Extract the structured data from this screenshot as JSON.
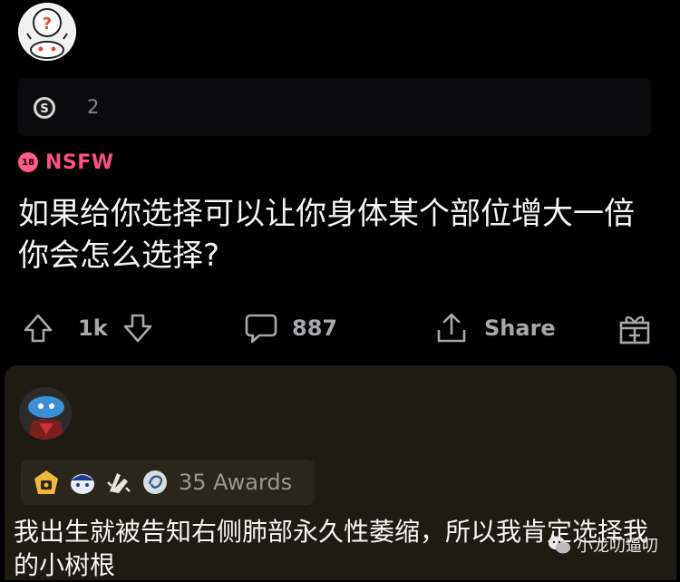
{
  "post": {
    "award_count": "2",
    "nsfw_badge": "18",
    "nsfw_label": "NSFW",
    "title": "如果给你选择可以让你身体某个部位增大一倍你会怎么选择?",
    "upvotes": "1k",
    "comments": "887",
    "share_label": "Share"
  },
  "comment": {
    "awards_label": "35 Awards",
    "text": "我出生就被告知右侧肺部永久性萎缩，所以我肯定选择我的小树根"
  },
  "watermark": {
    "text": "小龙叨逼叨"
  },
  "icons": {
    "award_coin": "silver-award-icon",
    "upvote": "upvote-arrow-icon",
    "downvote": "downvote-arrow-icon",
    "comment": "comment-bubble-icon",
    "share": "share-icon",
    "gift": "gift-award-icon"
  },
  "colors": {
    "background": "#000000",
    "nsfw": "#ff4f7e",
    "comment_card": "#1e1b12",
    "muted_text": "#a8a8ac"
  }
}
